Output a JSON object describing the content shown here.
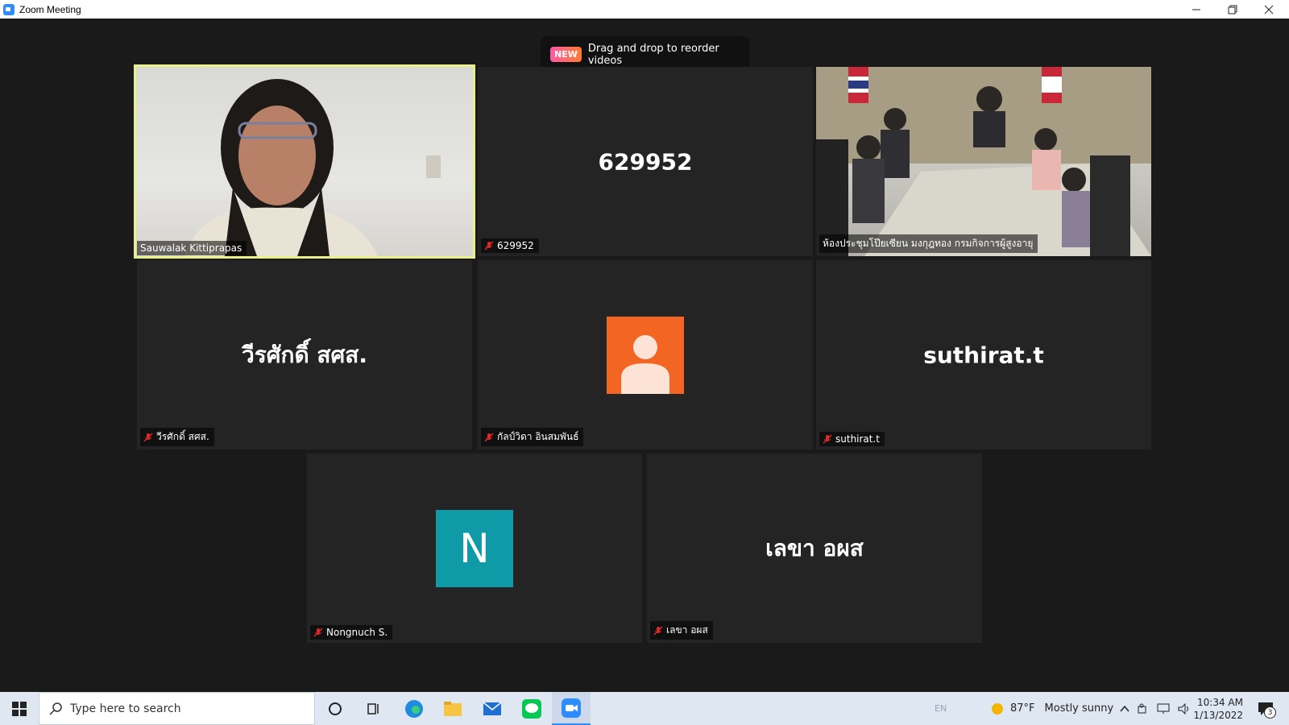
{
  "window": {
    "title": "Zoom Meeting"
  },
  "toast": {
    "badge": "NEW",
    "text": "Drag and drop to reorder videos"
  },
  "participants": [
    {
      "name": "Sauwalak Kittiprapas",
      "video": true,
      "active_speaker": true,
      "muted": false
    },
    {
      "name": "629952",
      "display": "629952",
      "muted": true
    },
    {
      "name": "ห้องประชุมโป๊ยเซียน มงกุฎทอง กรมกิจการผู้สูงอายุ",
      "video": true,
      "muted": false
    },
    {
      "name": "วีรศักดิ์ สศส.",
      "display": "วีรศักดิ์ สศส.",
      "muted": true
    },
    {
      "name": "กัลป์วิดา อินสมพันธ์",
      "avatar": "person-silhouette",
      "avatar_color": "#f26522",
      "muted": true
    },
    {
      "name": "suthirat.t",
      "display": "suthirat.t",
      "muted": true
    },
    {
      "name": "Nongnuch S.",
      "avatar_letter": "N",
      "avatar_color": "#0e9aa7",
      "muted": true
    },
    {
      "name": "เลขา อผส",
      "display": "เลขา อผส",
      "muted": true
    }
  ],
  "taskbar": {
    "search_placeholder": "Type here to search",
    "lang": "EN",
    "weather": {
      "temp": "87°F",
      "desc": "Mostly sunny"
    },
    "time": "10:34 AM",
    "date": "1/13/2022",
    "notifications": "3"
  },
  "colors": {
    "active_border": "#e7f08a",
    "muted_mic": "#e02828",
    "zoom_blue": "#2d8cff"
  }
}
